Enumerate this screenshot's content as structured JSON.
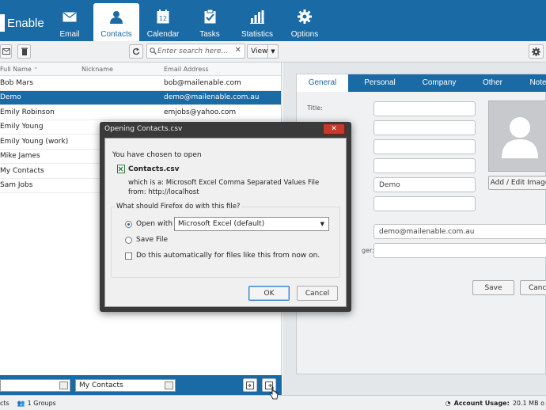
{
  "app": {
    "logo_text": "Enable"
  },
  "nav": [
    {
      "label": "Email",
      "icon": "envelope-icon"
    },
    {
      "label": "Contacts",
      "icon": "person-icon",
      "active": true
    },
    {
      "label": "Calendar",
      "icon": "calendar-icon",
      "day": "12"
    },
    {
      "label": "Tasks",
      "icon": "clipboard-check-icon"
    },
    {
      "label": "Statistics",
      "icon": "bar-chart-icon"
    },
    {
      "label": "Options",
      "icon": "gear-icon"
    }
  ],
  "toolbar": {
    "search_placeholder": "Enter search here...",
    "view_label": "View"
  },
  "list": {
    "columns": [
      "Full Name",
      "Nickname",
      "Email Address"
    ],
    "rows": [
      {
        "name": "Bob Mars",
        "nickname": "",
        "email": "bob@mailenable.com"
      },
      {
        "name": "Demo",
        "nickname": "",
        "email": "demo@mailenable.com.au",
        "selected": true
      },
      {
        "name": "Emily Robinson",
        "nickname": "",
        "email": "emjobs@yahoo.com"
      },
      {
        "name": "Emily Young",
        "nickname": "",
        "email": ""
      },
      {
        "name": "Emily Young (work)",
        "nickname": "",
        "email": ""
      },
      {
        "name": "Mike James",
        "nickname": "",
        "email": ""
      },
      {
        "name": "My Contacts",
        "nickname": "",
        "email": ""
      },
      {
        "name": "Sam Jobs",
        "nickname": "",
        "email": ""
      }
    ]
  },
  "bottom": {
    "folder_select": "My Contacts"
  },
  "status": {
    "contacts": "cts",
    "groups": "1 Groups",
    "usage_label": "Account Usage:",
    "usage_value": "20.1 MB o"
  },
  "detail": {
    "tabs": [
      "General",
      "Personal",
      "Company",
      "Other",
      "Note"
    ],
    "labels": {
      "title": "Title:",
      "manager": "ger:"
    },
    "fields": {
      "name": "Demo",
      "email": "demo@mailenable.com.au"
    },
    "add_image": "Add / Edit Image",
    "save": "Save",
    "cancel": "Cance"
  },
  "dialog": {
    "title": "Opening Contacts.csv",
    "intro": "You have chosen to open",
    "filename": "Contacts.csv",
    "which_is_label": "which is a:",
    "which_is_value": "Microsoft Excel Comma Separated Values File",
    "from_label": "from:",
    "from_value": "http://localhost",
    "question": "What should Firefox do with this file?",
    "open_with": "Open with",
    "app_select": "Microsoft Excel (default)",
    "save_file": "Save File",
    "auto": "Do this automatically for files like this from now on.",
    "ok": "OK",
    "cancel": "Cancel"
  }
}
